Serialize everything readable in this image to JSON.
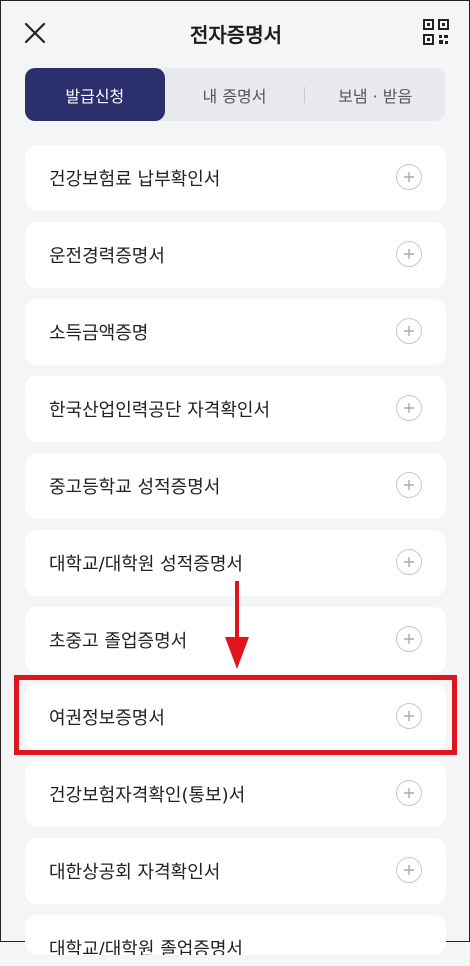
{
  "header": {
    "title": "전자증명서"
  },
  "tabs": [
    {
      "label": "발급신청",
      "active": true
    },
    {
      "label": "내 증명서",
      "active": false
    },
    {
      "label": "보냄 · 받음",
      "active": false
    }
  ],
  "items": [
    "건강보험료 납부확인서",
    "운전경력증명서",
    "소득금액증명",
    "한국산업인력공단 자격확인서",
    "중고등학교 성적증명서",
    "대학교/대학원 성적증명서",
    "초중고 졸업증명서",
    "여권정보증명서",
    "건강보험자격확인(통보)서",
    "대한상공회 자격확인서",
    "대학교/대학원 졸업증명서"
  ],
  "annotation": {
    "highlighted_item": "여권정보증명서",
    "color": "#e0141d"
  },
  "colors": {
    "accent": "#2b2f6b",
    "background": "#f4f5f7"
  }
}
